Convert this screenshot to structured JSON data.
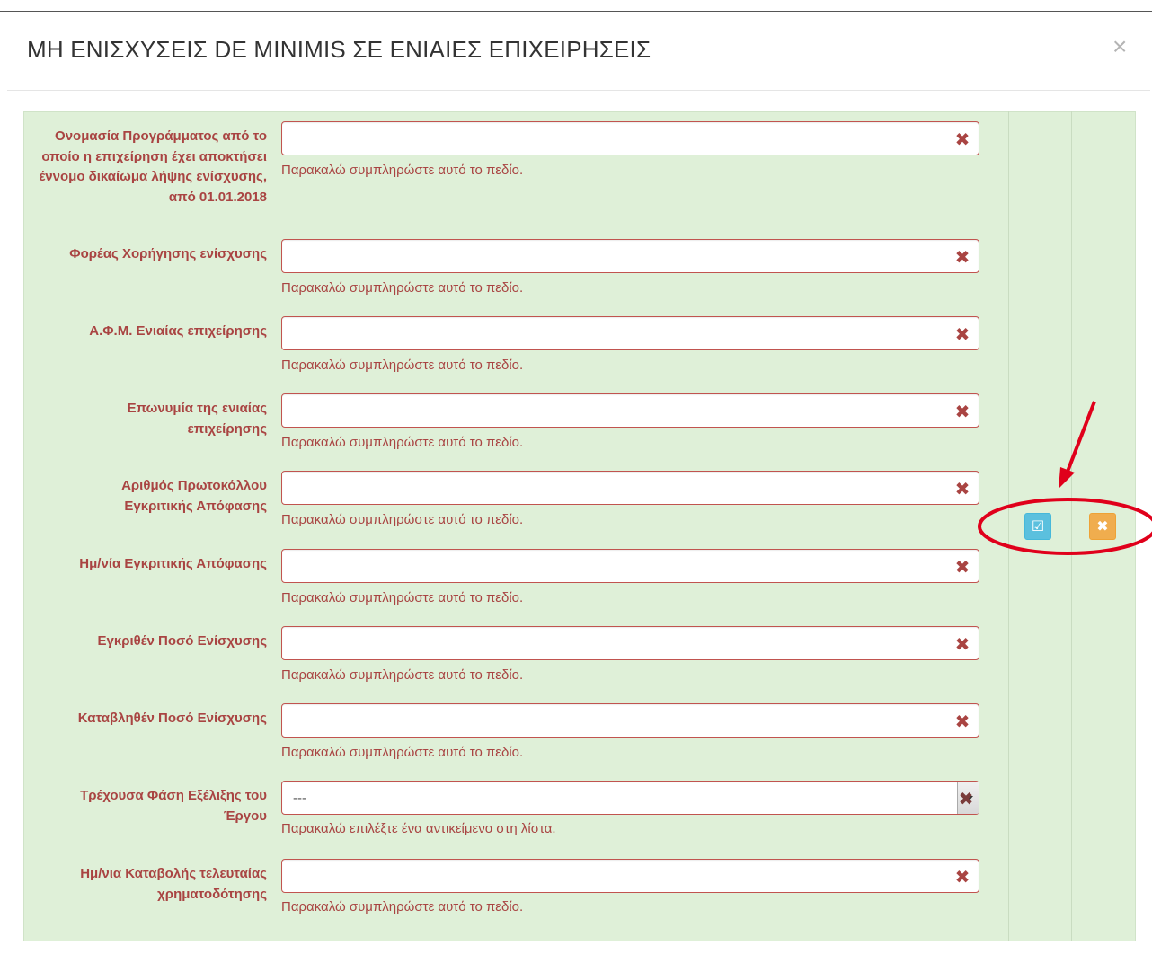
{
  "modal": {
    "title": "ΜΗ ΕΝΙΣΧΥΣΕΙΣ DE MINIMIS ΣΕ ΕΝΙΑΙΕΣ ΕΠΙΧΕΙΡΗΣΕΙΣ",
    "close_glyph": "×"
  },
  "form": {
    "fields": [
      {
        "label": "Ονομασία Προγράμματος από το οποίο η επιχείρηση έχει αποκτήσει έννομο δικαίωμα λήψης ενίσχυσης, από 01.01.2018",
        "value": "",
        "help": "Παρακαλώ συμπληρώστε αυτό το πεδίο."
      },
      {
        "label": "Φορέας Χορήγησης ενίσχυσης",
        "value": "",
        "help": "Παρακαλώ συμπληρώστε αυτό το πεδίο."
      },
      {
        "label": "Α.Φ.Μ. Ενιαίας επιχείρησης",
        "value": "",
        "help": "Παρακαλώ συμπληρώστε αυτό το πεδίο."
      },
      {
        "label": "Επωνυμία της ενιαίας επιχείρησης",
        "value": "",
        "help": "Παρακαλώ συμπληρώστε αυτό το πεδίο."
      },
      {
        "label": "Αριθμός Πρωτοκόλλου Εγκριτικής Απόφασης",
        "value": "",
        "help": "Παρακαλώ συμπληρώστε αυτό το πεδίο."
      },
      {
        "label": "Ημ/νία Εγκριτικής Απόφασης",
        "value": "",
        "help": "Παρακαλώ συμπληρώστε αυτό το πεδίο."
      },
      {
        "label": "Εγκριθέν Ποσό Ενίσχυσης",
        "value": "",
        "help": "Παρακαλώ συμπληρώστε αυτό το πεδίο."
      },
      {
        "label": "Καταβληθέν Ποσό Ενίσχυσης",
        "value": "",
        "help": "Παρακαλώ συμπληρώστε αυτό το πεδίο."
      },
      {
        "label": "Τρέχουσα Φάση Εξέλιξης του Έργου",
        "value": "---",
        "help": "Παρακαλώ επιλέξτε ένα αντικείμενο στη λίστα."
      },
      {
        "label": "Ημ/νια Καταβολής τελευταίας χρηματοδότησης",
        "value": "",
        "help": "Παρακαλώ συμπληρώστε αυτό το πεδίο."
      }
    ],
    "clear_glyph": "✖"
  },
  "actions": {
    "save_icon": "check-square-icon",
    "save_glyph": "☑",
    "cancel_icon": "times-icon",
    "cancel_glyph": "✖"
  },
  "colors": {
    "panel_bg": "#dff0d8",
    "error": "#a94442",
    "save_btn": "#5bc0de",
    "cancel_btn": "#f0ad4e",
    "annotation": "#e0001b"
  }
}
